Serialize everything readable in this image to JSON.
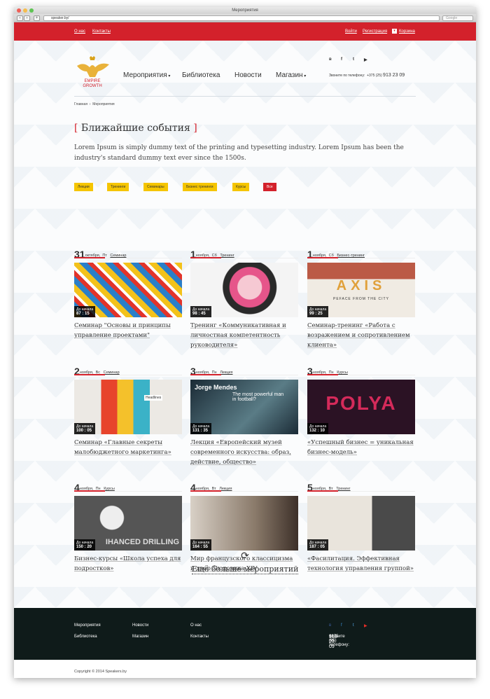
{
  "browser": {
    "window_title": "Мероприятия",
    "address": "speaker.by/",
    "search_placeholder": "Google"
  },
  "topbar": {
    "about": "О нас",
    "contacts": "Контакты",
    "login": "Войти",
    "register": "Регистрация",
    "cart": "Корзина"
  },
  "logo": {
    "line1": "EMPIRE",
    "line2": "GROWTH"
  },
  "nav": [
    "Мероприятия",
    "Библиотека",
    "Новости",
    "Магазин"
  ],
  "social": [
    "в",
    "f",
    "t",
    "▶"
  ],
  "phone": {
    "label": "Звоните по телефону:",
    "code": "+375 (25)",
    "number": "913 23 09"
  },
  "breadcrumb": {
    "home": "Главная",
    "current": "Мероприятия"
  },
  "heading": {
    "open": "[",
    "text": "Ближайшие события",
    "close": "]"
  },
  "lead": "Lorem Ipsum is simply dummy text of the printing and typesetting industry. Lorem Ipsum has been the industry's standard dummy text ever since the 1500s.",
  "filters": [
    "Лекции",
    "Тренинги",
    "Семинары",
    "Бизнес тренинги",
    "Курсы",
    "Все"
  ],
  "countdown_label": "До начала",
  "events": [
    {
      "day": "31",
      "month": "октября,",
      "dow": "Пт",
      "type": "Семинар",
      "countdown": "87 : 15",
      "title": "Семинар \"Основы и принципы управление проектами\""
    },
    {
      "day": "1",
      "month": "ноября,",
      "dow": "Сб",
      "type": "Тренинг",
      "countdown": "98 : 45",
      "title": "Тренинг «Коммуникативная и личностная компетентность руководителя»"
    },
    {
      "day": "1",
      "month": "ноября,",
      "dow": "Сб",
      "type": "Бизнес-тренинг",
      "countdown": "99 : 25",
      "title": "Семинар-тренинг «Работа с возражением и сопротивлением клиента»"
    },
    {
      "day": "2",
      "month": "ноября,",
      "dow": "Вс",
      "type": "Семинар",
      "countdown": "100 : 05",
      "title": "Семинар «Главные секреты малобюджетного маркетинга»"
    },
    {
      "day": "3",
      "month": "ноября,",
      "dow": "Пн",
      "type": "Лекция",
      "countdown": "131 : 35",
      "title": "Лекция «Европейский музей современного искусства: образ, действие, общество»"
    },
    {
      "day": "3",
      "month": "ноября,",
      "dow": "Пн",
      "type": "Курсы",
      "countdown": "132 : 10",
      "title": "«Успешный бизнес = уникальная бизнес-модель»"
    },
    {
      "day": "4",
      "month": "ноября,",
      "dow": "Пн",
      "type": "Курсы",
      "countdown": "150 : 20",
      "title": "Бизнес-курсы «Школа успеха для подростков»"
    },
    {
      "day": "4",
      "month": "ноября,",
      "dow": "Вт",
      "type": "Лекция",
      "countdown": "164 : 55",
      "title": "Мир французского классицизма и двор Людовика XIV"
    },
    {
      "day": "5",
      "month": "ноября,",
      "dow": "Вт",
      "type": "Тренинг",
      "countdown": "187 : 05",
      "title": "«Фасилитация. Эффективная технология управления группой»"
    }
  ],
  "image_text": {
    "axis": "AXIS",
    "axis_sub": "PEFACE FROM THE CITY",
    "jorge": "Jorge Mendes",
    "jorge_sub": "The most powerful man in football?",
    "polya": "POLYA",
    "drilling": "IHANCED DRILLING",
    "headlines": "Headlines"
  },
  "more": {
    "icon": "⟳",
    "label": "Ещё больше мероприятий"
  },
  "footer": {
    "col1": [
      "Мероприятия",
      "Библиотека"
    ],
    "col2": [
      "Новости",
      "Магазин"
    ],
    "col3": [
      "О нас",
      "Контакты"
    ],
    "phone_label": "Звоните по телефону:",
    "code": "+375 (25)",
    "number": "913 23 09"
  },
  "copyright": "Copyright © 2014 Speakers.by"
}
